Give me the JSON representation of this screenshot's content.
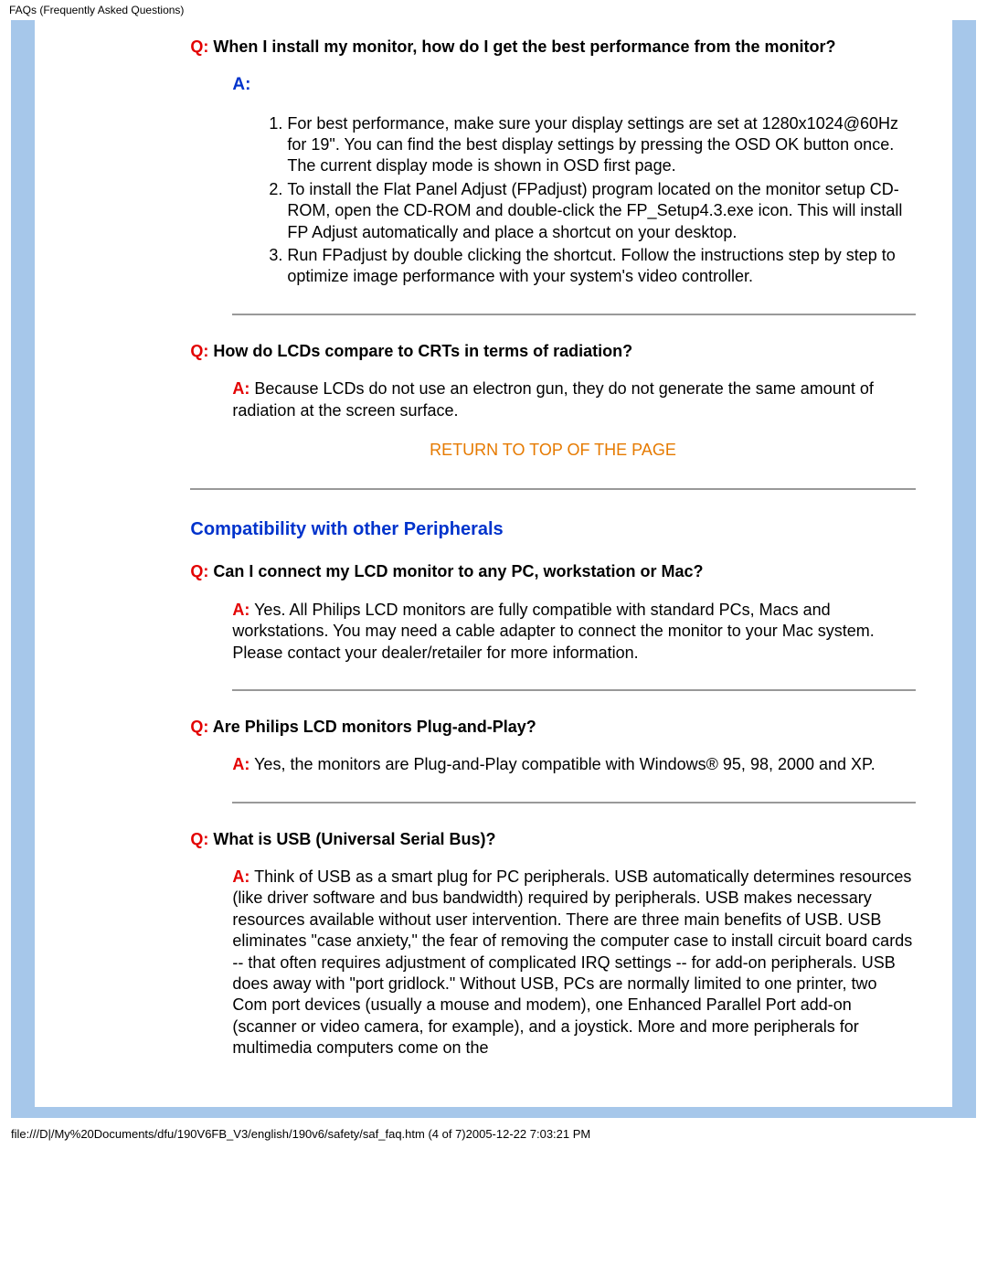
{
  "header": "FAQs (Frequently Asked Questions)",
  "faq1": {
    "q_prefix": "Q:",
    "q_text": " When I install my monitor, how do I get the best performance from the monitor?",
    "a_label": "A:",
    "steps": [
      "For best performance, make sure your display settings are set at 1280x1024@60Hz for 19\". You can find the best display settings by pressing the OSD OK button once. The current display mode is shown in OSD first page.",
      "To install the Flat Panel Adjust (FPadjust) program located on the monitor setup CD-ROM, open the CD-ROM and double-click the FP_Setup4.3.exe icon. This will install FP Adjust automatically and place a shortcut on your desktop.",
      "Run FPadjust by double clicking the shortcut. Follow the instructions step by step to optimize image performance with your system's video controller."
    ]
  },
  "faq2": {
    "q_prefix": "Q:",
    "q_text": " How do LCDs compare to CRTs in terms of radiation?",
    "a_prefix": "A:",
    "a_text": " Because LCDs do not use an electron gun, they do not generate the same amount of radiation at the screen surface."
  },
  "return_label": "RETURN TO TOP OF THE PAGE",
  "section2_title": "Compatibility with other Peripherals",
  "faq3": {
    "q_prefix": "Q:",
    "q_text": " Can I connect my LCD monitor to any PC, workstation or Mac?",
    "a_prefix": "A:",
    "a_text": " Yes. All Philips LCD monitors are fully compatible with standard PCs, Macs and workstations. You may need a cable adapter to connect the monitor to your Mac system. Please contact your dealer/retailer for more information."
  },
  "faq4": {
    "q_prefix": "Q:",
    "q_text": " Are Philips LCD monitors Plug-and-Play?",
    "a_prefix": "A:",
    "a_text": " Yes, the monitors are Plug-and-Play compatible with Windows® 95, 98, 2000 and XP."
  },
  "faq5": {
    "q_prefix": "Q:",
    "q_text": " What is USB (Universal Serial Bus)?",
    "a_prefix": "A:",
    "a_text": " Think of USB as a smart plug for PC peripherals. USB automatically determines resources (like driver software and bus bandwidth) required by peripherals. USB makes necessary resources available without user intervention. There are three main benefits of USB. USB eliminates \"case anxiety,\" the fear of removing the computer case to install circuit board cards -- that often requires adjustment of complicated IRQ settings -- for add-on peripherals. USB does away with \"port gridlock.\" Without USB, PCs are normally limited to one printer, two Com port devices (usually a mouse and modem), one Enhanced Parallel Port add-on (scanner or video camera, for example), and a joystick. More and more peripherals for multimedia computers come on the"
  },
  "footer_path": "file:///D|/My%20Documents/dfu/190V6FB_V3/english/190v6/safety/saf_faq.htm (4 of 7)2005-12-22 7:03:21 PM"
}
